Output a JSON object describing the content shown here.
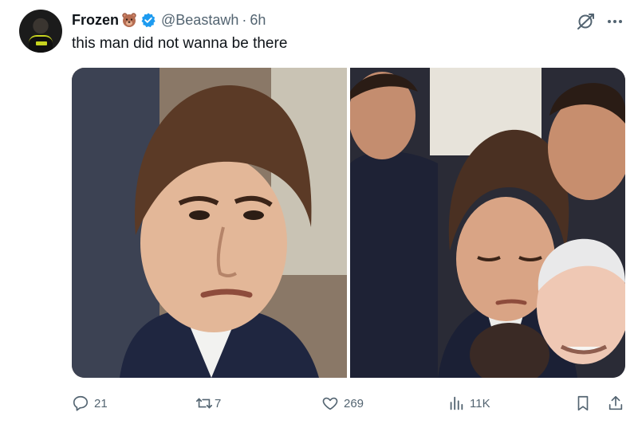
{
  "author": {
    "name": "Frozen",
    "emoji_badge": "bear-face",
    "verified_color": "#1d9bf0",
    "handle": "@Beastawh",
    "separator": "·",
    "time": "6h"
  },
  "tweet_text": "this man did not wanna be there",
  "media": {
    "count": 2,
    "left_image": "Close-up of a young man with brown hair frowning, wearing a dark suit",
    "right_image": "Young man with eyes closed standing among a crowd, older men beside him"
  },
  "actions": {
    "replies": "21",
    "reposts": "7",
    "likes": "269",
    "views": "11K"
  },
  "colors": {
    "text": "#0f1419",
    "secondary": "#536471",
    "accent": "#1d9bf0"
  }
}
